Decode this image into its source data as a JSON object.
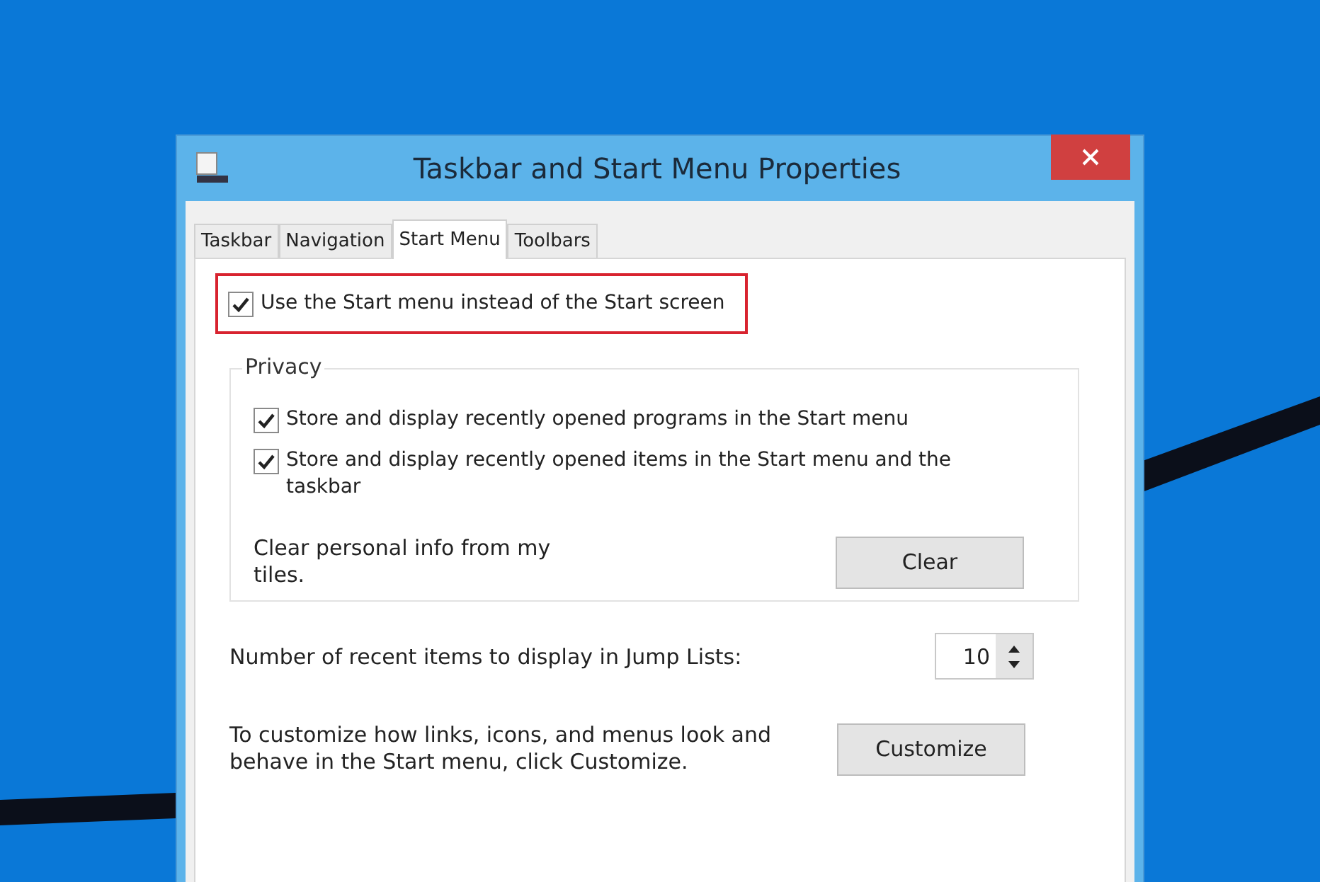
{
  "window": {
    "title": "Taskbar and Start Menu Properties"
  },
  "tabs": [
    {
      "label": "Taskbar",
      "selected": false
    },
    {
      "label": "Navigation",
      "selected": false
    },
    {
      "label": "Start Menu",
      "selected": true
    },
    {
      "label": "Toolbars",
      "selected": false
    }
  ],
  "start_menu_option": {
    "label": "Use the Start menu instead of the Start screen",
    "checked": true,
    "highlighted": true
  },
  "privacy": {
    "title": "Privacy",
    "options": [
      {
        "label": "Store and display recently opened programs in the Start menu",
        "checked": true
      },
      {
        "label": "Store and display recently opened items in the Start menu and the taskbar",
        "checked": true
      }
    ],
    "clear_text": "Clear personal info from my tiles.",
    "clear_button": "Clear"
  },
  "jump_lists": {
    "label": "Number of recent items to display in Jump Lists:",
    "value": "10"
  },
  "customize": {
    "text": "To customize how links, icons, and menus look and behave in the Start menu, click Customize.",
    "button": "Customize"
  }
}
